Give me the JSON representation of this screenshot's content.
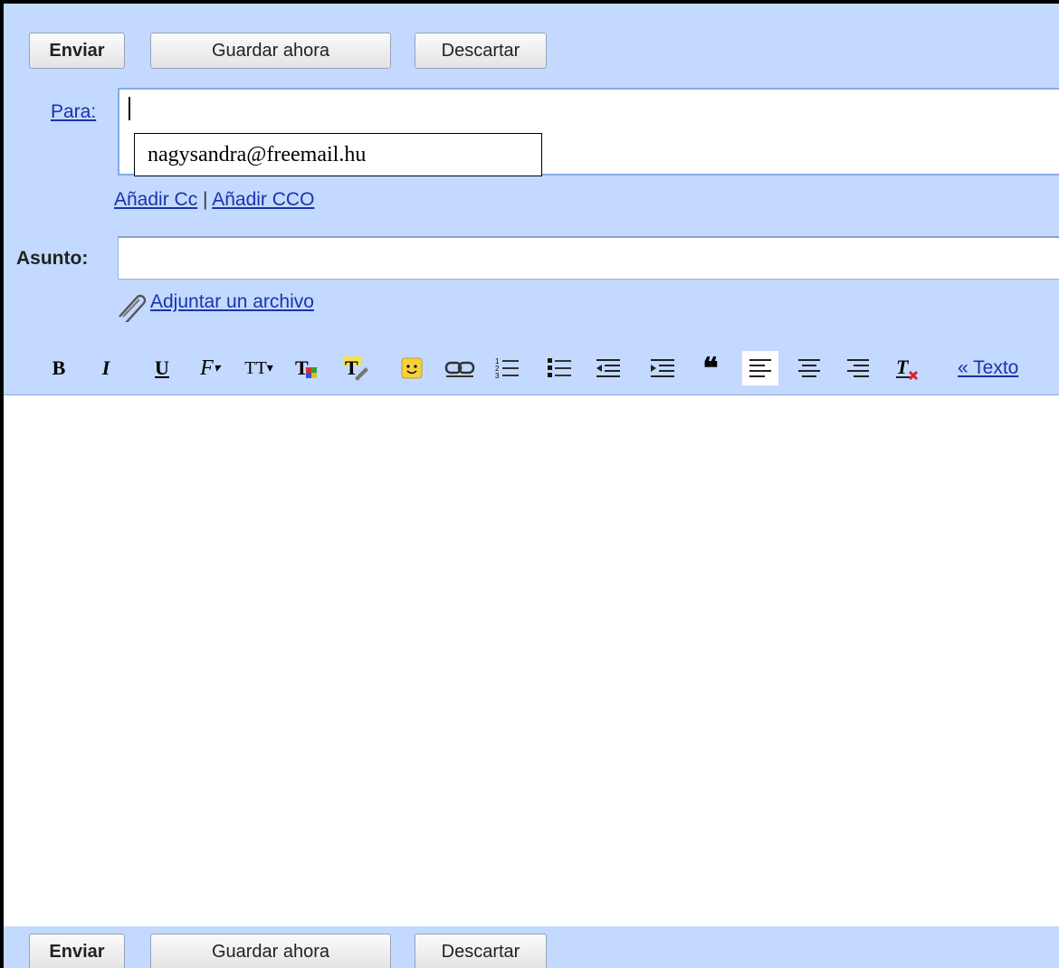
{
  "top_buttons": {
    "send": "Enviar",
    "save": "Guardar ahora",
    "discard": "Descartar"
  },
  "to": {
    "label": "Para:",
    "recipient": "nagysandra@freemail.hu"
  },
  "cc_links": {
    "add_cc": "Añadir Cc",
    "separator": "|",
    "add_bcc": "Añadir CCO"
  },
  "subject": {
    "label": "Asunto:",
    "value": ""
  },
  "attach": {
    "label": "Adjuntar un archivo"
  },
  "toolbar": {
    "bold": "B",
    "italic": "I",
    "underline": "U",
    "font": "F",
    "size": "TT",
    "plain_text_link": "« Texto"
  },
  "bottom_buttons": {
    "send": "Enviar",
    "save": "Guardar ahora",
    "discard": "Descartar"
  },
  "colors": {
    "panel": "#c3d9ff",
    "link": "#1a33aa",
    "field_border": "#86a9e6"
  }
}
